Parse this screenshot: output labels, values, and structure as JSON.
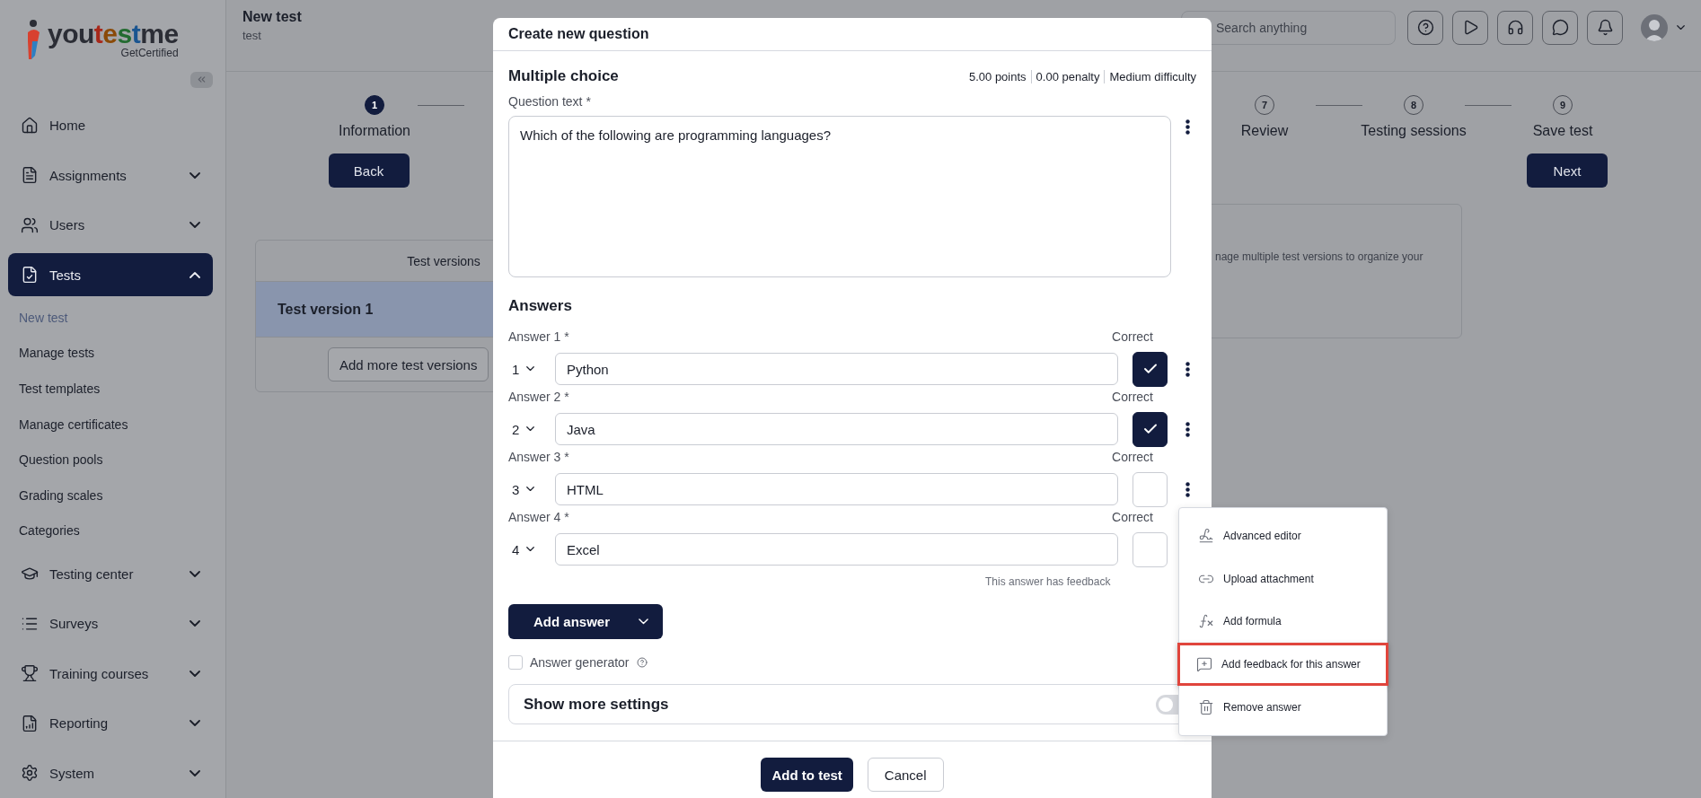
{
  "sidebar": {
    "logo": {
      "word": "youtestme",
      "tagline": "GetCertified"
    },
    "items": [
      {
        "kind": "link",
        "label": "Home"
      },
      {
        "kind": "group",
        "label": "Assignments",
        "expanded": false,
        "selected": false
      },
      {
        "kind": "group",
        "label": "Users",
        "expanded": false,
        "selected": false
      },
      {
        "kind": "group",
        "label": "Tests",
        "expanded": true,
        "selected": true,
        "children": [
          {
            "label": "New test",
            "selected": true
          },
          {
            "label": "Manage tests",
            "selected": false
          },
          {
            "label": "Test templates",
            "selected": false
          },
          {
            "label": "Manage certificates",
            "selected": false
          },
          {
            "label": "Question pools",
            "selected": false
          },
          {
            "label": "Grading scales",
            "selected": false
          },
          {
            "label": "Categories",
            "selected": false
          }
        ]
      },
      {
        "kind": "group",
        "label": "Testing center",
        "expanded": false,
        "selected": false
      },
      {
        "kind": "group",
        "label": "Surveys",
        "expanded": false,
        "selected": false
      },
      {
        "kind": "group",
        "label": "Training courses",
        "expanded": false,
        "selected": false
      },
      {
        "kind": "group",
        "label": "Reporting",
        "expanded": false,
        "selected": false
      },
      {
        "kind": "group",
        "label": "System",
        "expanded": false,
        "selected": false
      }
    ]
  },
  "header": {
    "title": "New test",
    "subtitle": "test",
    "search": {
      "placeholder": "Search anything"
    }
  },
  "stepper": {
    "steps": [
      {
        "number": "1",
        "label": "Information",
        "selected": true
      },
      {
        "number": "7",
        "label": "Review",
        "selected": false
      },
      {
        "number": "8",
        "label": "Testing sessions",
        "selected": false
      },
      {
        "number": "9",
        "label": "Save test",
        "selected": false
      }
    ],
    "back": "Back",
    "next": "Next"
  },
  "versions": {
    "heading": "Test versions",
    "items": [
      {
        "label": "Test version 1",
        "selected": true
      }
    ],
    "add_button": "Add more test versions"
  },
  "info_card": {
    "text": "nage multiple test versions to organize your"
  },
  "dialog": {
    "title": "Create new question",
    "type": "Multiple choice",
    "meta": [
      "5.00 points",
      "0.00 penalty",
      "Medium difficulty"
    ],
    "question_label": "Question text *",
    "question": "Which of the following are programming languages?",
    "answers_heading": "Answers",
    "answers": [
      {
        "label": "Answer 1 *",
        "order": "1",
        "value": "Python",
        "correct_label": "Correct",
        "checked": true
      },
      {
        "label": "Answer 2 *",
        "order": "2",
        "value": "Java",
        "correct_label": "Correct",
        "checked": true
      },
      {
        "label": "Answer 3 *",
        "order": "3",
        "value": "HTML",
        "correct_label": "Correct",
        "checked": false
      },
      {
        "label": "Answer 4 *",
        "order": "4",
        "value": "Excel",
        "correct_label": "Correct",
        "checked": false,
        "note": "This answer has feedback"
      }
    ],
    "add_answer": "Add answer",
    "generator": {
      "label": "Answer generator",
      "checked": false
    },
    "settings": {
      "label": "Show more settings",
      "on": false
    },
    "buttons": [
      "Add to test",
      "Cancel"
    ]
  },
  "menu": {
    "items": [
      {
        "label": "Advanced editor",
        "highlighted": false
      },
      {
        "label": "Upload attachment",
        "highlighted": false
      },
      {
        "label": "Add formula",
        "highlighted": false
      },
      {
        "label": "Add feedback for this answer",
        "highlighted": true
      },
      {
        "label": "Remove answer",
        "highlighted": false
      }
    ]
  }
}
